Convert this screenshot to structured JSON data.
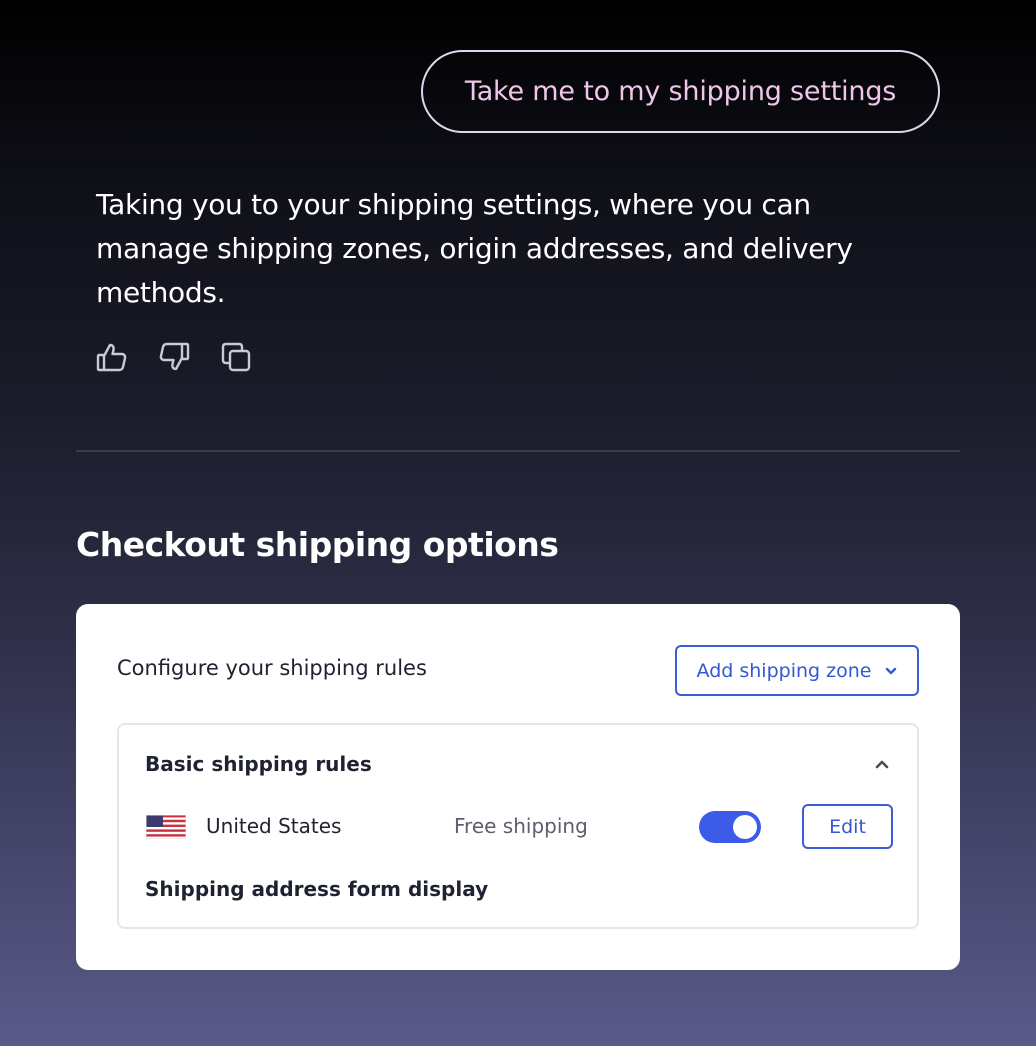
{
  "chat": {
    "user_message": "Take me to my shipping settings",
    "assistant_message": "Taking you to your shipping settings, where you can manage shipping zones, origin addresses, and delivery methods.",
    "actions": [
      {
        "icon": "thumbs-up-icon"
      },
      {
        "icon": "thumbs-down-icon"
      },
      {
        "icon": "copy-icon"
      }
    ]
  },
  "section": {
    "title": "Checkout shipping options"
  },
  "card": {
    "header_label": "Configure your shipping rules",
    "add_zone_label": "Add shipping zone",
    "rules": {
      "title": "Basic shipping rules",
      "country": "United States",
      "shipping_type": "Free shipping",
      "enabled": true,
      "edit_label": "Edit",
      "address_form_label": "Shipping address form display"
    }
  },
  "colors": {
    "accent": "#3b5bdb",
    "user_text": "#efc6ea"
  }
}
